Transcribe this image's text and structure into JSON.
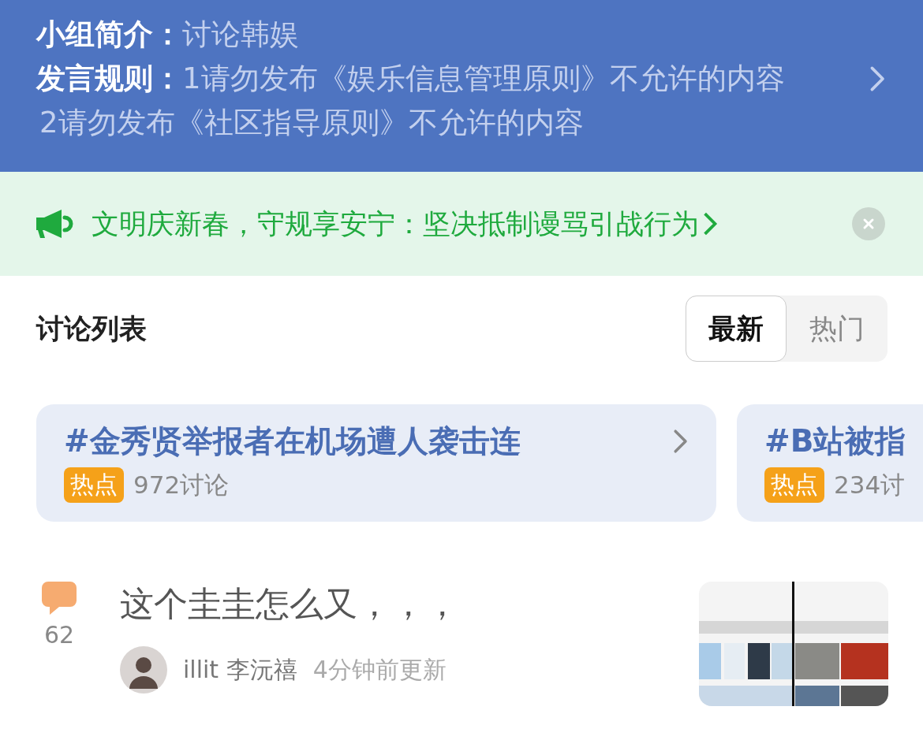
{
  "group_info": {
    "intro_label": "小组简介：",
    "intro": "讨论韩娱",
    "rules_label": "发言规则：",
    "rules": [
      "1请勿发布《娱乐信息管理原则》不允许的内容",
      "2请勿发布《社区指导原则》不允许的内容"
    ]
  },
  "notice": {
    "text": "文明庆新春，守规享安宁：坚决抵制谩骂引战行为"
  },
  "section": {
    "title": "讨论列表",
    "tabs": [
      {
        "label": "最新",
        "selected": true
      },
      {
        "label": "热门",
        "selected": false
      }
    ]
  },
  "topics": [
    {
      "title": "#金秀贤举报者在机场遭人袭击连",
      "badge": "热点",
      "count": "972讨论"
    },
    {
      "title": "#B站被指",
      "badge": "热点",
      "count": "234讨"
    }
  ],
  "posts": [
    {
      "comments": "62",
      "title": "这个圭圭怎么又，，，",
      "author": "illit 李沅禧",
      "time": "4分钟前更新"
    }
  ]
}
